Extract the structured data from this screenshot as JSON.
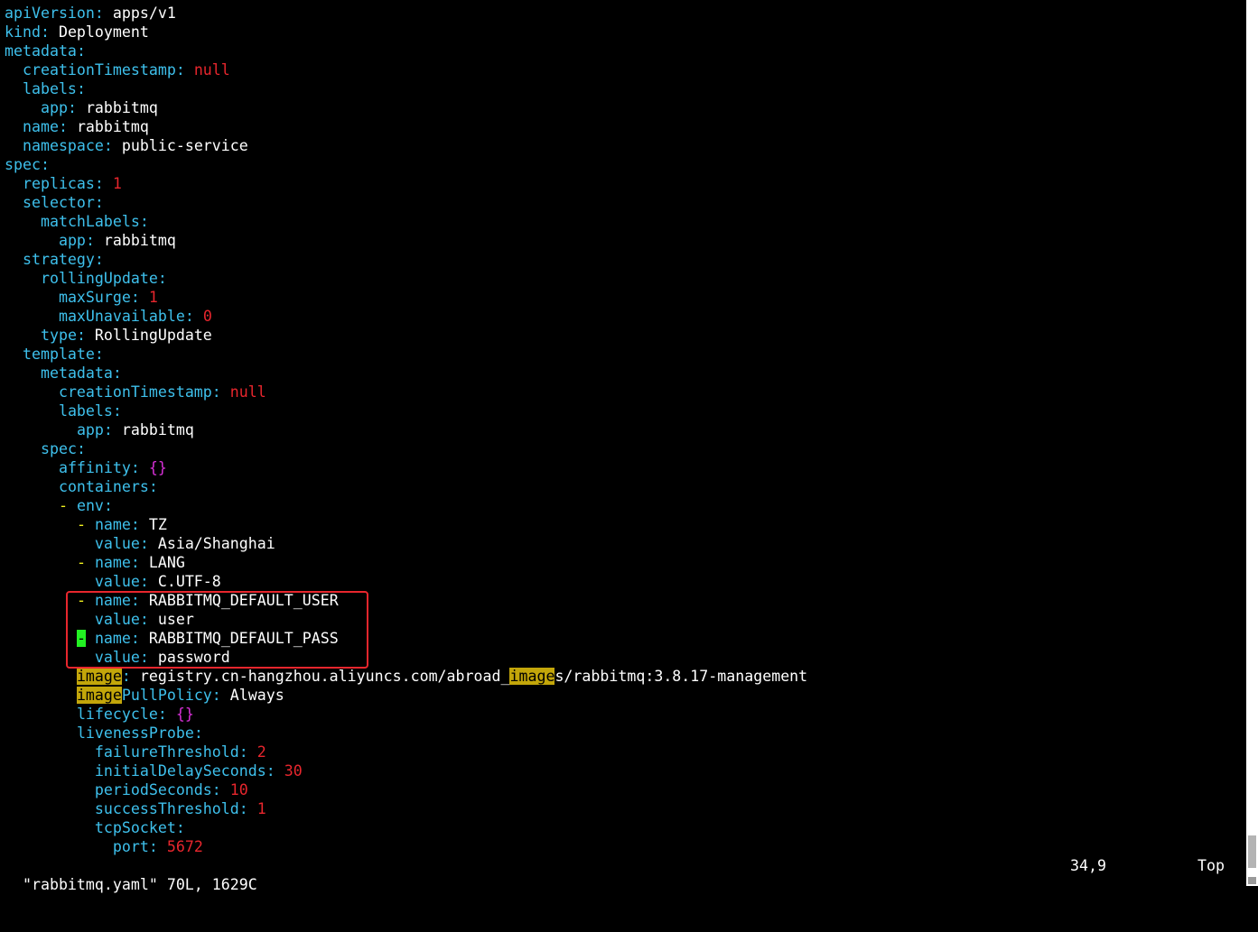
{
  "file": {
    "name": "rabbitmq.yaml",
    "lines": [
      {
        "indent": "",
        "parts": [
          {
            "t": "apiVersion",
            "c": "k"
          },
          {
            "t": ": ",
            "c": "p"
          },
          {
            "t": "apps/v1",
            "c": "v"
          }
        ]
      },
      {
        "indent": "",
        "parts": [
          {
            "t": "kind",
            "c": "k"
          },
          {
            "t": ": ",
            "c": "p"
          },
          {
            "t": "Deployment",
            "c": "v"
          }
        ]
      },
      {
        "indent": "",
        "parts": [
          {
            "t": "metadata",
            "c": "k"
          },
          {
            "t": ":",
            "c": "p"
          }
        ]
      },
      {
        "indent": "  ",
        "parts": [
          {
            "t": "creationTimestamp",
            "c": "k"
          },
          {
            "t": ": ",
            "c": "p"
          },
          {
            "t": "null",
            "c": "n"
          }
        ]
      },
      {
        "indent": "  ",
        "parts": [
          {
            "t": "labels",
            "c": "k"
          },
          {
            "t": ":",
            "c": "p"
          }
        ]
      },
      {
        "indent": "    ",
        "parts": [
          {
            "t": "app",
            "c": "k"
          },
          {
            "t": ": ",
            "c": "p"
          },
          {
            "t": "rabbitmq",
            "c": "v"
          }
        ]
      },
      {
        "indent": "  ",
        "parts": [
          {
            "t": "name",
            "c": "k"
          },
          {
            "t": ": ",
            "c": "p"
          },
          {
            "t": "rabbitmq",
            "c": "v"
          }
        ]
      },
      {
        "indent": "  ",
        "parts": [
          {
            "t": "namespace",
            "c": "k"
          },
          {
            "t": ": ",
            "c": "p"
          },
          {
            "t": "public-service",
            "c": "v"
          }
        ]
      },
      {
        "indent": "",
        "parts": [
          {
            "t": "spec",
            "c": "k"
          },
          {
            "t": ":",
            "c": "p"
          }
        ]
      },
      {
        "indent": "  ",
        "parts": [
          {
            "t": "replicas",
            "c": "k"
          },
          {
            "t": ": ",
            "c": "p"
          },
          {
            "t": "1",
            "c": "n"
          }
        ]
      },
      {
        "indent": "  ",
        "parts": [
          {
            "t": "selector",
            "c": "k"
          },
          {
            "t": ":",
            "c": "p"
          }
        ]
      },
      {
        "indent": "    ",
        "parts": [
          {
            "t": "matchLabels",
            "c": "k"
          },
          {
            "t": ":",
            "c": "p"
          }
        ]
      },
      {
        "indent": "      ",
        "parts": [
          {
            "t": "app",
            "c": "k"
          },
          {
            "t": ": ",
            "c": "p"
          },
          {
            "t": "rabbitmq",
            "c": "v"
          }
        ]
      },
      {
        "indent": "  ",
        "parts": [
          {
            "t": "strategy",
            "c": "k"
          },
          {
            "t": ":",
            "c": "p"
          }
        ]
      },
      {
        "indent": "    ",
        "parts": [
          {
            "t": "rollingUpdate",
            "c": "k"
          },
          {
            "t": ":",
            "c": "p"
          }
        ]
      },
      {
        "indent": "      ",
        "parts": [
          {
            "t": "maxSurge",
            "c": "k"
          },
          {
            "t": ": ",
            "c": "p"
          },
          {
            "t": "1",
            "c": "n"
          }
        ]
      },
      {
        "indent": "      ",
        "parts": [
          {
            "t": "maxUnavailable",
            "c": "k"
          },
          {
            "t": ": ",
            "c": "p"
          },
          {
            "t": "0",
            "c": "n"
          }
        ]
      },
      {
        "indent": "    ",
        "parts": [
          {
            "t": "type",
            "c": "k"
          },
          {
            "t": ": ",
            "c": "p"
          },
          {
            "t": "RollingUpdate",
            "c": "v"
          }
        ]
      },
      {
        "indent": "  ",
        "parts": [
          {
            "t": "template",
            "c": "k"
          },
          {
            "t": ":",
            "c": "p"
          }
        ]
      },
      {
        "indent": "    ",
        "parts": [
          {
            "t": "metadata",
            "c": "k"
          },
          {
            "t": ":",
            "c": "p"
          }
        ]
      },
      {
        "indent": "      ",
        "parts": [
          {
            "t": "creationTimestamp",
            "c": "k"
          },
          {
            "t": ": ",
            "c": "p"
          },
          {
            "t": "null",
            "c": "n"
          }
        ]
      },
      {
        "indent": "      ",
        "parts": [
          {
            "t": "labels",
            "c": "k"
          },
          {
            "t": ":",
            "c": "p"
          }
        ]
      },
      {
        "indent": "        ",
        "parts": [
          {
            "t": "app",
            "c": "k"
          },
          {
            "t": ": ",
            "c": "p"
          },
          {
            "t": "rabbitmq",
            "c": "v"
          }
        ]
      },
      {
        "indent": "    ",
        "parts": [
          {
            "t": "spec",
            "c": "k"
          },
          {
            "t": ":",
            "c": "p"
          }
        ]
      },
      {
        "indent": "      ",
        "parts": [
          {
            "t": "affinity",
            "c": "k"
          },
          {
            "t": ": ",
            "c": "p"
          },
          {
            "t": "{}",
            "c": "br"
          }
        ]
      },
      {
        "indent": "      ",
        "parts": [
          {
            "t": "containers",
            "c": "k"
          },
          {
            "t": ":",
            "c": "p"
          }
        ]
      },
      {
        "indent": "      ",
        "parts": [
          {
            "t": "-",
            "c": "d"
          },
          {
            "t": " ",
            "c": "v"
          },
          {
            "t": "env",
            "c": "k"
          },
          {
            "t": ":",
            "c": "p"
          }
        ]
      },
      {
        "indent": "        ",
        "parts": [
          {
            "t": "-",
            "c": "d"
          },
          {
            "t": " ",
            "c": "v"
          },
          {
            "t": "name",
            "c": "k"
          },
          {
            "t": ": ",
            "c": "p"
          },
          {
            "t": "TZ",
            "c": "v"
          }
        ]
      },
      {
        "indent": "          ",
        "parts": [
          {
            "t": "value",
            "c": "k"
          },
          {
            "t": ": ",
            "c": "p"
          },
          {
            "t": "Asia/Shanghai",
            "c": "v"
          }
        ]
      },
      {
        "indent": "        ",
        "parts": [
          {
            "t": "-",
            "c": "d"
          },
          {
            "t": " ",
            "c": "v"
          },
          {
            "t": "name",
            "c": "k"
          },
          {
            "t": ": ",
            "c": "p"
          },
          {
            "t": "LANG",
            "c": "v"
          }
        ]
      },
      {
        "indent": "          ",
        "parts": [
          {
            "t": "value",
            "c": "k"
          },
          {
            "t": ": ",
            "c": "p"
          },
          {
            "t": "C.UTF-8",
            "c": "v"
          }
        ]
      },
      {
        "indent": "        ",
        "parts": [
          {
            "t": "-",
            "c": "d"
          },
          {
            "t": " ",
            "c": "v"
          },
          {
            "t": "name",
            "c": "k"
          },
          {
            "t": ": ",
            "c": "p"
          },
          {
            "t": "RABBITMQ_DEFAULT_USER",
            "c": "v"
          }
        ]
      },
      {
        "indent": "          ",
        "parts": [
          {
            "t": "value",
            "c": "k"
          },
          {
            "t": ": ",
            "c": "p"
          },
          {
            "t": "user",
            "c": "v"
          }
        ]
      },
      {
        "indent": "        ",
        "parts": [
          {
            "t": "-",
            "c": "cur"
          },
          {
            "t": " ",
            "c": "v"
          },
          {
            "t": "name",
            "c": "k"
          },
          {
            "t": ": ",
            "c": "p"
          },
          {
            "t": "RABBITMQ_DEFAULT_PASS",
            "c": "v"
          }
        ]
      },
      {
        "indent": "          ",
        "parts": [
          {
            "t": "value",
            "c": "k"
          },
          {
            "t": ": ",
            "c": "p"
          },
          {
            "t": "password",
            "c": "v"
          }
        ]
      },
      {
        "indent": "        ",
        "parts": [
          {
            "t": "image",
            "c": "hl"
          },
          {
            "t": ": ",
            "c": "p"
          },
          {
            "t": "registry.cn-hangzhou.aliyuncs.com/abroad_",
            "c": "v"
          },
          {
            "t": "image",
            "c": "hl"
          },
          {
            "t": "s/rabbitmq:3.8.17-management",
            "c": "v"
          }
        ]
      },
      {
        "indent": "        ",
        "parts": [
          {
            "t": "image",
            "c": "hl"
          },
          {
            "t": "PullPolicy",
            "c": "k"
          },
          {
            "t": ": ",
            "c": "p"
          },
          {
            "t": "Always",
            "c": "v"
          }
        ]
      },
      {
        "indent": "        ",
        "parts": [
          {
            "t": "lifecycle",
            "c": "k"
          },
          {
            "t": ": ",
            "c": "p"
          },
          {
            "t": "{}",
            "c": "br"
          }
        ]
      },
      {
        "indent": "        ",
        "parts": [
          {
            "t": "livenessProbe",
            "c": "k"
          },
          {
            "t": ":",
            "c": "p"
          }
        ]
      },
      {
        "indent": "          ",
        "parts": [
          {
            "t": "failureThreshold",
            "c": "k"
          },
          {
            "t": ": ",
            "c": "p"
          },
          {
            "t": "2",
            "c": "n"
          }
        ]
      },
      {
        "indent": "          ",
        "parts": [
          {
            "t": "initialDelaySeconds",
            "c": "k"
          },
          {
            "t": ": ",
            "c": "p"
          },
          {
            "t": "30",
            "c": "n"
          }
        ]
      },
      {
        "indent": "          ",
        "parts": [
          {
            "t": "periodSeconds",
            "c": "k"
          },
          {
            "t": ": ",
            "c": "p"
          },
          {
            "t": "10",
            "c": "n"
          }
        ]
      },
      {
        "indent": "          ",
        "parts": [
          {
            "t": "successThreshold",
            "c": "k"
          },
          {
            "t": ": ",
            "c": "p"
          },
          {
            "t": "1",
            "c": "n"
          }
        ]
      },
      {
        "indent": "          ",
        "parts": [
          {
            "t": "tcpSocket",
            "c": "k"
          },
          {
            "t": ":",
            "c": "p"
          }
        ]
      },
      {
        "indent": "            ",
        "parts": [
          {
            "t": "port",
            "c": "k"
          },
          {
            "t": ": ",
            "c": "p"
          },
          {
            "t": "5672",
            "c": "n"
          }
        ]
      }
    ]
  },
  "status": {
    "file_info": "\"rabbitmq.yaml\" 70L, 1629C",
    "cursor_pos": "34,9",
    "scroll_pos": "Top"
  },
  "colors": {
    "background": "#000000",
    "key": "#3ec0ec",
    "value": "#ffffff",
    "number": "#e8262d",
    "brace": "#d730d7",
    "dash": "#f2f21f",
    "cursor": "#22f122",
    "search_highlight": "#c3a60a",
    "annotation_box": "#e8262d"
  }
}
